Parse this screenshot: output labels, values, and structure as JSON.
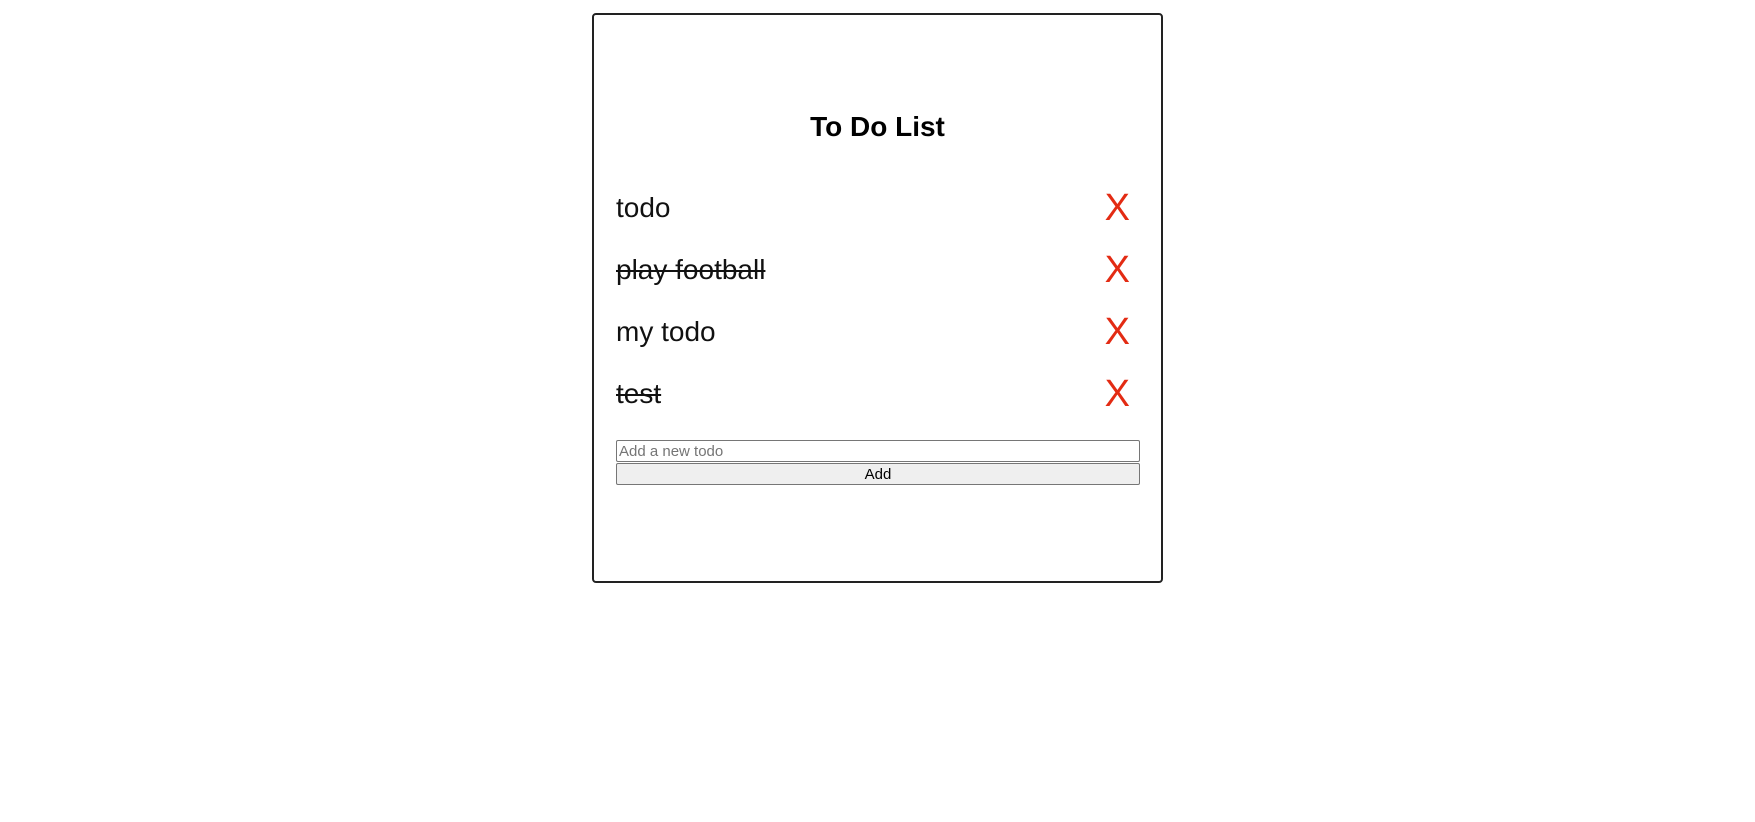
{
  "app": {
    "title": "To Do List"
  },
  "todos": [
    {
      "text": "todo",
      "completed": false,
      "delete_label": "X"
    },
    {
      "text": "play football",
      "completed": true,
      "delete_label": "X"
    },
    {
      "text": "my todo",
      "completed": false,
      "delete_label": "X"
    },
    {
      "text": "test",
      "completed": true,
      "delete_label": "X"
    }
  ],
  "form": {
    "input_value": "",
    "input_placeholder": "Add a new todo",
    "add_label": "Add"
  },
  "colors": {
    "delete": "#e32b13",
    "border": "#222222",
    "button_bg": "#efefef"
  }
}
